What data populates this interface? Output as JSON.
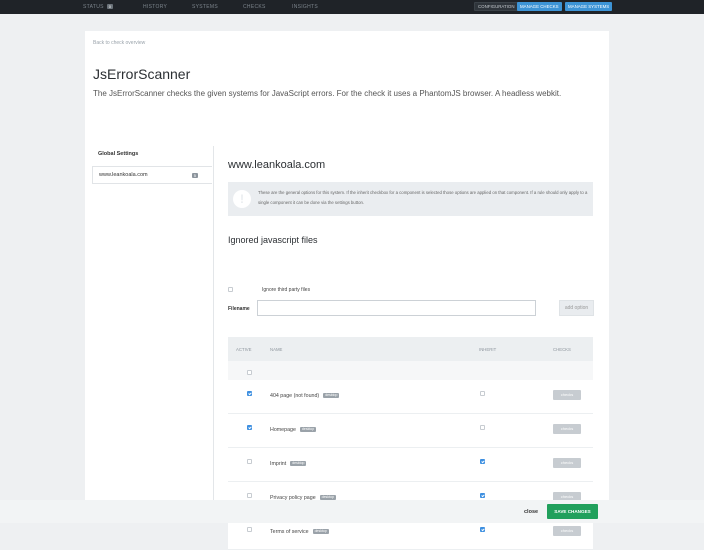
{
  "nav": {
    "items": [
      {
        "label": "STATUS",
        "badge": "0"
      },
      {
        "label": "HISTORY"
      },
      {
        "label": "SYSTEMS"
      },
      {
        "label": "CHECKS"
      },
      {
        "label": "INSIGHTS"
      }
    ],
    "config_label": "CONFIGURATION",
    "manage_checks_label": "MANAGE CHECKS",
    "manage_systems_label": "MANAGE SYSTEMS"
  },
  "page": {
    "back_link": "Back to check overview",
    "title": "JsErrorScanner",
    "description": "The JsErrorScanner checks the given systems for JavaScript errors. For the check it uses a PhantomJS browser. A headless webkit."
  },
  "sidebar": {
    "heading": "Global Settings",
    "items": [
      {
        "label": "www.leankoala.com",
        "count": "5"
      }
    ]
  },
  "main": {
    "system_title": "www.leankoala.com",
    "info_text": "These are the general options for this system. If the inherit checkbox for a component is selected those options are applied on that component. If a rule should only apply to a single component it can be done via the settings button.",
    "section_title": "Ignored javascript files",
    "ignore_third_party_label": "Ignore third party files",
    "ignore_third_party_checked": false,
    "filename_label": "Filename",
    "filename_value": "",
    "add_option_label": "add option"
  },
  "table": {
    "headers": {
      "active": "ACTIVE",
      "name": "NAME",
      "inherit": "INHERIT",
      "checks": "CHECKS"
    },
    "rows": [
      {
        "name": "404 page (not found)",
        "tag": "desktop",
        "active": true,
        "inherit": false,
        "checks_label": "checks"
      },
      {
        "name": "Homepage",
        "tag": "desktop",
        "active": true,
        "inherit": false,
        "checks_label": "checks"
      },
      {
        "name": "Imprint",
        "tag": "desktop",
        "active": false,
        "inherit": true,
        "checks_label": "checks"
      },
      {
        "name": "Privacy policy page",
        "tag": "desktop",
        "active": false,
        "inherit": true,
        "checks_label": "checks"
      },
      {
        "name": "Terms of service",
        "tag": "desktop",
        "active": false,
        "inherit": true,
        "checks_label": "checks"
      }
    ]
  },
  "footer": {
    "close_label": "close",
    "save_label": "SAVE CHANGES"
  },
  "colors": {
    "topbar": "#1f2328",
    "accent_blue": "#3d94d6",
    "save_green": "#21a05c"
  }
}
